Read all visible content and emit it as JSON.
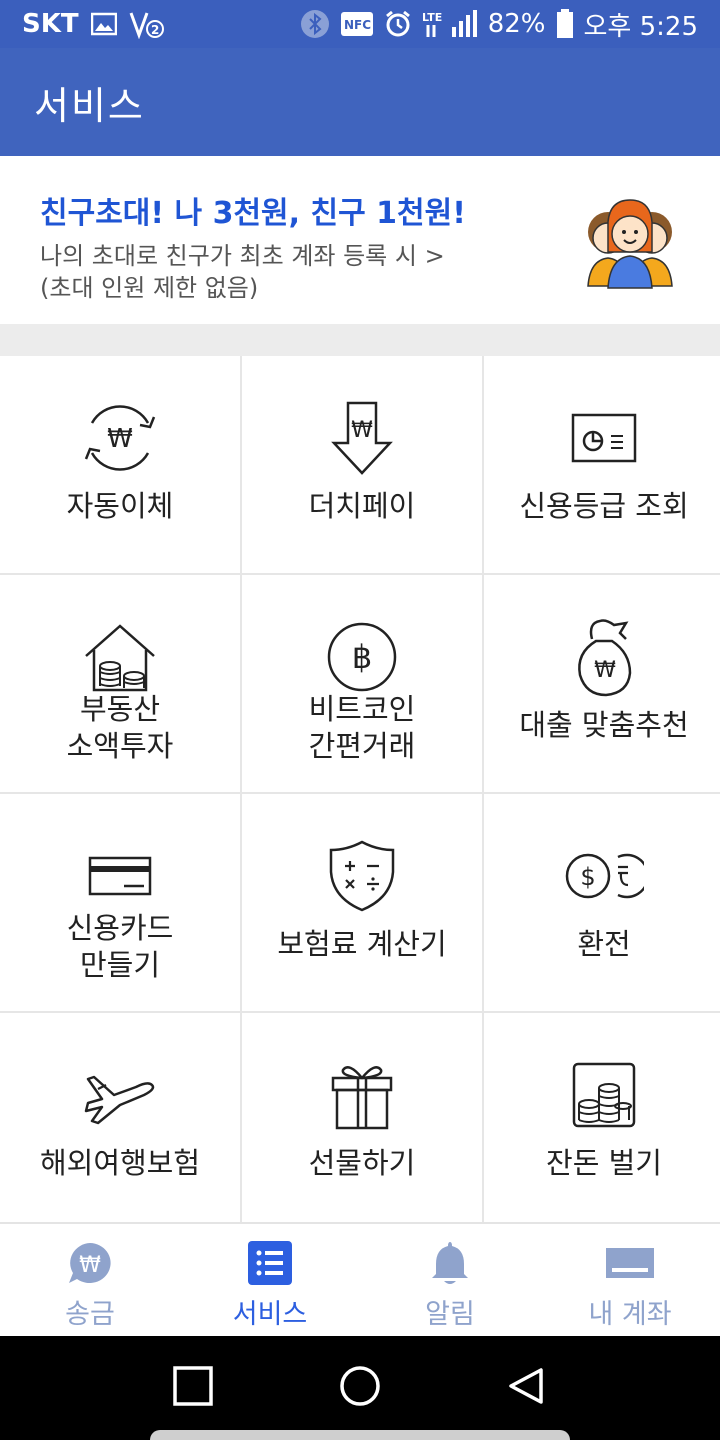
{
  "status_bar": {
    "carrier": "SKT",
    "nfc": "NFC",
    "lte": "LTE",
    "battery": "82%",
    "time": "오후 5:25"
  },
  "app_bar": {
    "title": "서비스"
  },
  "promo": {
    "headline": "친구초대! 나 3천원, 친구 1천원!",
    "line1": "나의 초대로 친구가 최초 계좌 등록 시 >",
    "line2": "(초대 인원 제한 없음)"
  },
  "services": [
    {
      "label": "자동이체",
      "icon": "auto-transfer-icon"
    },
    {
      "label": "더치페이",
      "icon": "dutch-pay-icon"
    },
    {
      "label": "신용등급 조회",
      "icon": "credit-rating-icon"
    },
    {
      "label": "부동산",
      "label2": "소액투자",
      "icon": "real-estate-icon"
    },
    {
      "label": "비트코인",
      "label2": "간편거래",
      "icon": "bitcoin-icon"
    },
    {
      "label": "대출 맞춤추천",
      "icon": "loan-icon"
    },
    {
      "label": "신용카드",
      "label2": "만들기",
      "icon": "credit-card-icon"
    },
    {
      "label": "보험료 계산기",
      "icon": "insurance-calculator-icon"
    },
    {
      "label": "환전",
      "icon": "currency-exchange-icon"
    },
    {
      "label": "해외여행보험",
      "icon": "airplane-icon"
    },
    {
      "label": "선물하기",
      "icon": "gift-icon"
    },
    {
      "label": "잔돈 벌기",
      "icon": "coin-jar-icon"
    }
  ],
  "bottom_nav": [
    {
      "label": "송금",
      "icon": "won-chat-icon"
    },
    {
      "label": "서비스",
      "icon": "list-icon",
      "active": true
    },
    {
      "label": "알림",
      "icon": "bell-icon"
    },
    {
      "label": "내 계좌",
      "icon": "account-icon"
    }
  ],
  "colors": {
    "primary": "#4064be",
    "accent": "#1f55d4",
    "nav_inactive": "#8fa3cc",
    "nav_active": "#2d5fe0"
  }
}
